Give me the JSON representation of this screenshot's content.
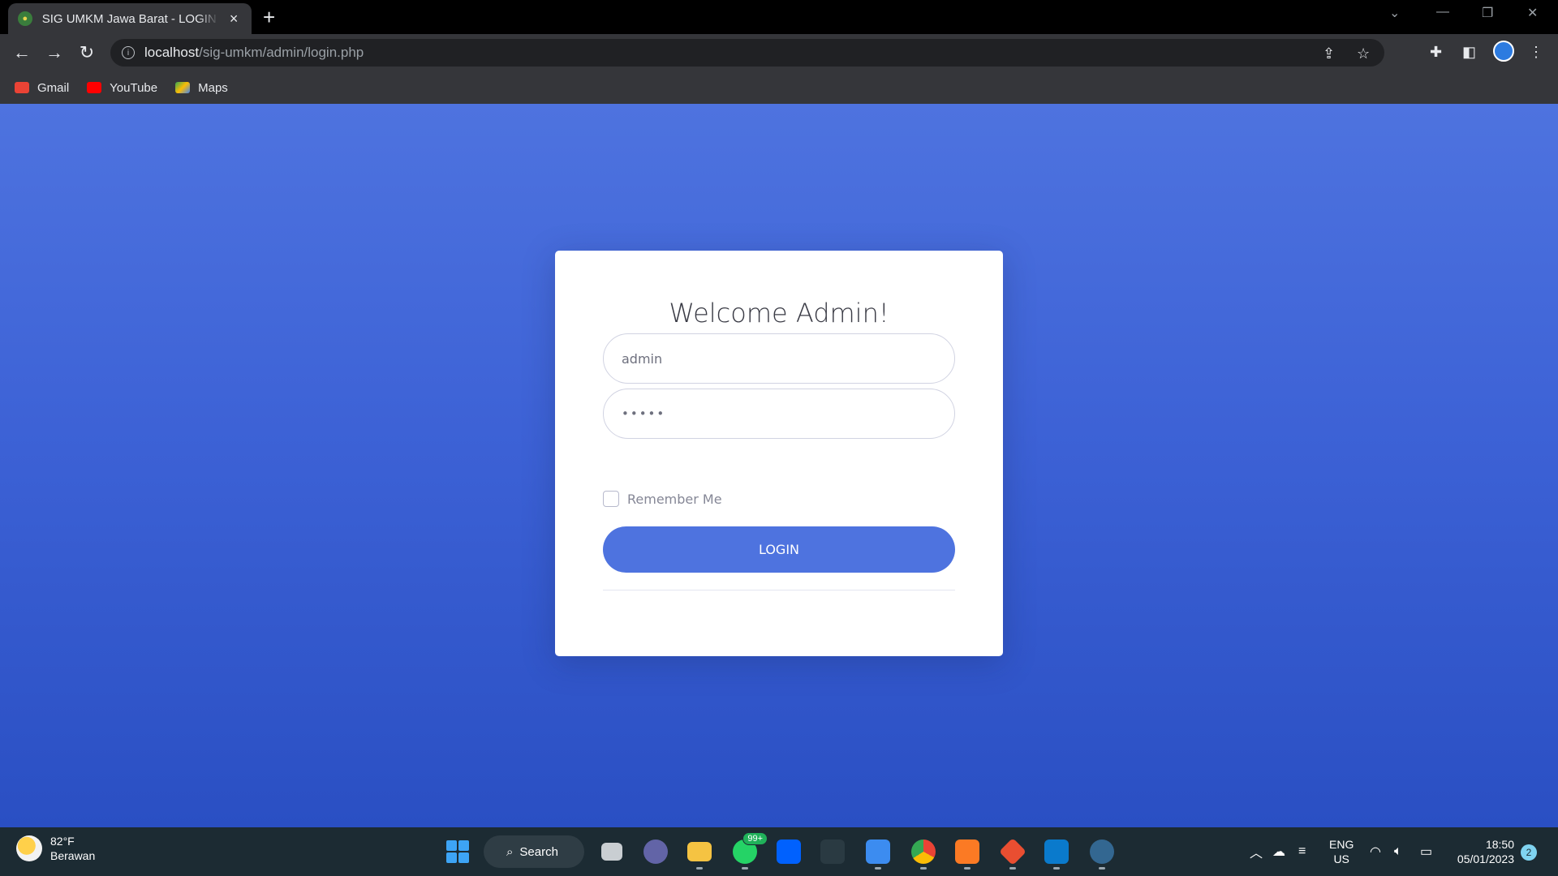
{
  "browser": {
    "tab": {
      "title": "SIG UMKM Jawa Barat - LOGIN ADMIN",
      "close_icon": "×"
    },
    "new_tab_icon": "+",
    "address": {
      "host": "localhost",
      "path": "/sig-umkm/admin/login.php"
    },
    "bookmarks": [
      {
        "label": "Gmail",
        "icon": "gmail-icon",
        "color": "#ea4335"
      },
      {
        "label": "YouTube",
        "icon": "youtube-icon",
        "color": "#ff0000"
      },
      {
        "label": "Maps",
        "icon": "maps-icon",
        "color": "#34a853"
      }
    ]
  },
  "login": {
    "title": "Welcome Admin!",
    "username_value": "admin",
    "password_value": "•••••",
    "remember_label": "Remember Me",
    "remember_checked": false,
    "login_label": "LOGIN"
  },
  "colors": {
    "primary": "#4e73df",
    "page_gradient_top": "#4e73df",
    "page_gradient_bottom": "#2a4fc3"
  },
  "taskbar": {
    "weather": {
      "temp": "82°F",
      "condition": "Berawan"
    },
    "search_label": "Search",
    "whatsapp_badge": "99+",
    "language": {
      "line1": "ENG",
      "line2": "US"
    },
    "clock": {
      "time": "18:50",
      "date": "05/01/2023"
    },
    "notifications": "2"
  }
}
